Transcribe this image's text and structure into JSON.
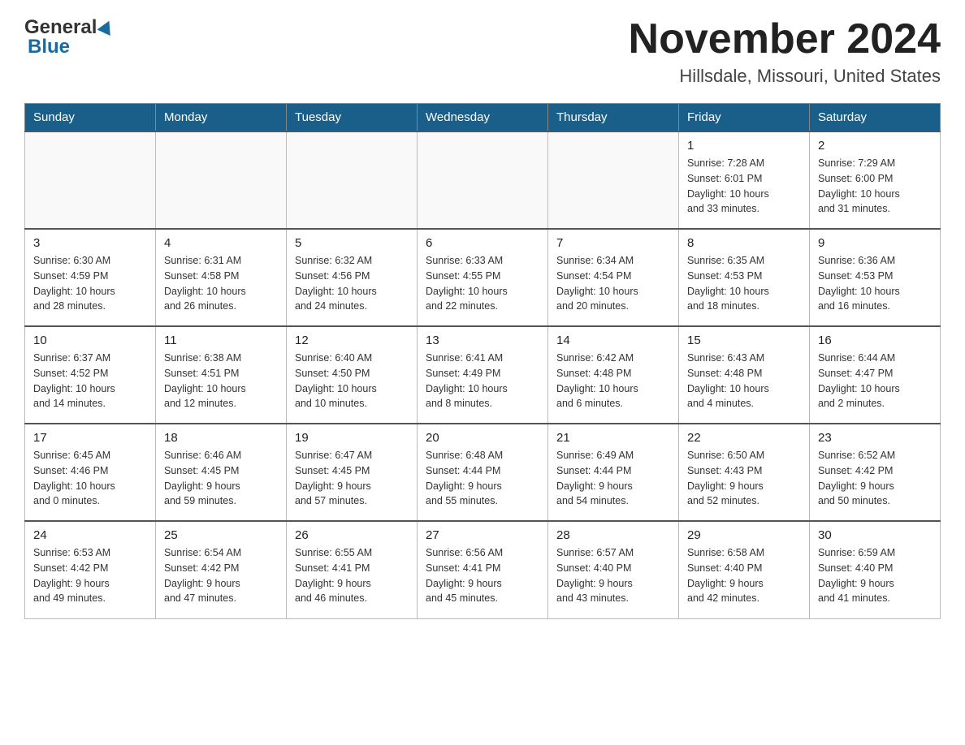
{
  "header": {
    "logo_general": "General",
    "logo_blue": "Blue",
    "month_title": "November 2024",
    "location": "Hillsdale, Missouri, United States"
  },
  "calendar": {
    "days_of_week": [
      "Sunday",
      "Monday",
      "Tuesday",
      "Wednesday",
      "Thursday",
      "Friday",
      "Saturday"
    ],
    "weeks": [
      [
        {
          "day": "",
          "info": ""
        },
        {
          "day": "",
          "info": ""
        },
        {
          "day": "",
          "info": ""
        },
        {
          "day": "",
          "info": ""
        },
        {
          "day": "",
          "info": ""
        },
        {
          "day": "1",
          "info": "Sunrise: 7:28 AM\nSunset: 6:01 PM\nDaylight: 10 hours\nand 33 minutes."
        },
        {
          "day": "2",
          "info": "Sunrise: 7:29 AM\nSunset: 6:00 PM\nDaylight: 10 hours\nand 31 minutes."
        }
      ],
      [
        {
          "day": "3",
          "info": "Sunrise: 6:30 AM\nSunset: 4:59 PM\nDaylight: 10 hours\nand 28 minutes."
        },
        {
          "day": "4",
          "info": "Sunrise: 6:31 AM\nSunset: 4:58 PM\nDaylight: 10 hours\nand 26 minutes."
        },
        {
          "day": "5",
          "info": "Sunrise: 6:32 AM\nSunset: 4:56 PM\nDaylight: 10 hours\nand 24 minutes."
        },
        {
          "day": "6",
          "info": "Sunrise: 6:33 AM\nSunset: 4:55 PM\nDaylight: 10 hours\nand 22 minutes."
        },
        {
          "day": "7",
          "info": "Sunrise: 6:34 AM\nSunset: 4:54 PM\nDaylight: 10 hours\nand 20 minutes."
        },
        {
          "day": "8",
          "info": "Sunrise: 6:35 AM\nSunset: 4:53 PM\nDaylight: 10 hours\nand 18 minutes."
        },
        {
          "day": "9",
          "info": "Sunrise: 6:36 AM\nSunset: 4:53 PM\nDaylight: 10 hours\nand 16 minutes."
        }
      ],
      [
        {
          "day": "10",
          "info": "Sunrise: 6:37 AM\nSunset: 4:52 PM\nDaylight: 10 hours\nand 14 minutes."
        },
        {
          "day": "11",
          "info": "Sunrise: 6:38 AM\nSunset: 4:51 PM\nDaylight: 10 hours\nand 12 minutes."
        },
        {
          "day": "12",
          "info": "Sunrise: 6:40 AM\nSunset: 4:50 PM\nDaylight: 10 hours\nand 10 minutes."
        },
        {
          "day": "13",
          "info": "Sunrise: 6:41 AM\nSunset: 4:49 PM\nDaylight: 10 hours\nand 8 minutes."
        },
        {
          "day": "14",
          "info": "Sunrise: 6:42 AM\nSunset: 4:48 PM\nDaylight: 10 hours\nand 6 minutes."
        },
        {
          "day": "15",
          "info": "Sunrise: 6:43 AM\nSunset: 4:48 PM\nDaylight: 10 hours\nand 4 minutes."
        },
        {
          "day": "16",
          "info": "Sunrise: 6:44 AM\nSunset: 4:47 PM\nDaylight: 10 hours\nand 2 minutes."
        }
      ],
      [
        {
          "day": "17",
          "info": "Sunrise: 6:45 AM\nSunset: 4:46 PM\nDaylight: 10 hours\nand 0 minutes."
        },
        {
          "day": "18",
          "info": "Sunrise: 6:46 AM\nSunset: 4:45 PM\nDaylight: 9 hours\nand 59 minutes."
        },
        {
          "day": "19",
          "info": "Sunrise: 6:47 AM\nSunset: 4:45 PM\nDaylight: 9 hours\nand 57 minutes."
        },
        {
          "day": "20",
          "info": "Sunrise: 6:48 AM\nSunset: 4:44 PM\nDaylight: 9 hours\nand 55 minutes."
        },
        {
          "day": "21",
          "info": "Sunrise: 6:49 AM\nSunset: 4:44 PM\nDaylight: 9 hours\nand 54 minutes."
        },
        {
          "day": "22",
          "info": "Sunrise: 6:50 AM\nSunset: 4:43 PM\nDaylight: 9 hours\nand 52 minutes."
        },
        {
          "day": "23",
          "info": "Sunrise: 6:52 AM\nSunset: 4:42 PM\nDaylight: 9 hours\nand 50 minutes."
        }
      ],
      [
        {
          "day": "24",
          "info": "Sunrise: 6:53 AM\nSunset: 4:42 PM\nDaylight: 9 hours\nand 49 minutes."
        },
        {
          "day": "25",
          "info": "Sunrise: 6:54 AM\nSunset: 4:42 PM\nDaylight: 9 hours\nand 47 minutes."
        },
        {
          "day": "26",
          "info": "Sunrise: 6:55 AM\nSunset: 4:41 PM\nDaylight: 9 hours\nand 46 minutes."
        },
        {
          "day": "27",
          "info": "Sunrise: 6:56 AM\nSunset: 4:41 PM\nDaylight: 9 hours\nand 45 minutes."
        },
        {
          "day": "28",
          "info": "Sunrise: 6:57 AM\nSunset: 4:40 PM\nDaylight: 9 hours\nand 43 minutes."
        },
        {
          "day": "29",
          "info": "Sunrise: 6:58 AM\nSunset: 4:40 PM\nDaylight: 9 hours\nand 42 minutes."
        },
        {
          "day": "30",
          "info": "Sunrise: 6:59 AM\nSunset: 4:40 PM\nDaylight: 9 hours\nand 41 minutes."
        }
      ]
    ]
  }
}
